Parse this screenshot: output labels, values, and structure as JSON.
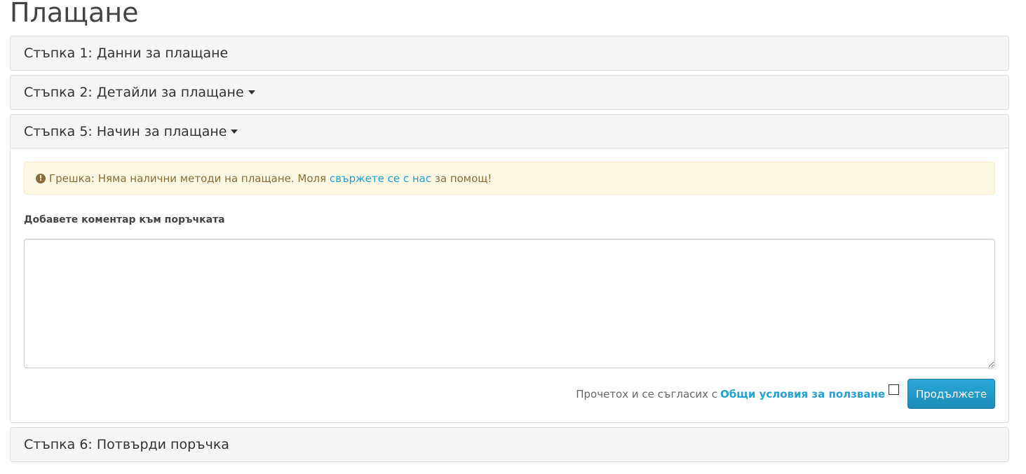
{
  "page": {
    "title": "Плащане"
  },
  "steps": [
    {
      "label": "Стъпка 1: Данни за плащане",
      "has_caret": false
    },
    {
      "label": "Стъпка 2: Детайли за плащане",
      "has_caret": true
    },
    {
      "label": "Стъпка 5: Начин за плащане",
      "has_caret": true
    },
    {
      "label": "Стъпка 6: Потвърди поръчка",
      "has_caret": false
    }
  ],
  "alert": {
    "text_before": "Грешка: Няма налични методи на плащане. Моля",
    "link_text": "свържете се с нас",
    "text_after": "за помощ!"
  },
  "comment": {
    "label": "Добавете коментар към поръчката",
    "value": ""
  },
  "agree": {
    "text": "Прочетох и се съгласих с",
    "link_text": "Общи условия за ползване",
    "checked": false
  },
  "buttons": {
    "continue": "Продължете"
  },
  "colors": {
    "accent": "#23a1d1",
    "alert_bg": "#fcf8e3",
    "alert_text": "#8a6d3b",
    "panel_heading_bg": "#f5f5f5"
  }
}
